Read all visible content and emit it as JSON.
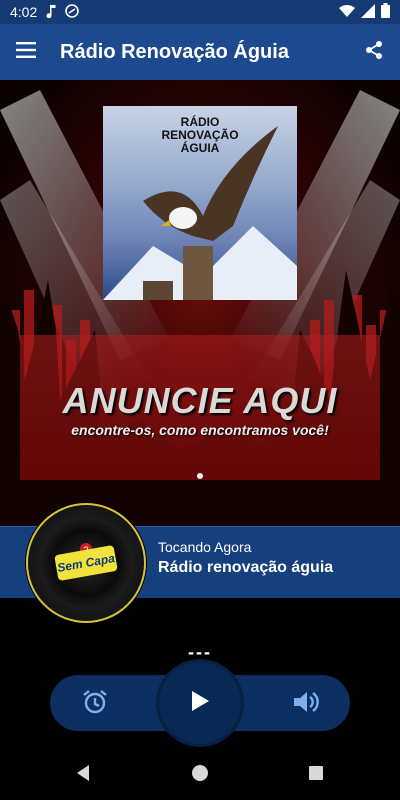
{
  "status_bar": {
    "time": "4:02"
  },
  "app_bar": {
    "title": "Rádio Renovação Águia"
  },
  "album_art": {
    "text_lines": [
      "RÁDIO",
      "RENOVAÇÃO",
      "ÁGUIA"
    ]
  },
  "banner": {
    "title": "ANUNCIE AQUI",
    "subtitle": "encontre-os, como encontramos você!"
  },
  "now_playing": {
    "label": "Tocando Agora",
    "station": "Rádio renovação águia",
    "cover_text": "Sem Capa"
  },
  "player": {
    "time_display": "---"
  },
  "colors": {
    "status_bar": "#153a74",
    "app_bar": "#1d4a8e",
    "now_playing": "#163f7e",
    "controls": "#0c2f62",
    "play_button": "#082855",
    "icon_blue": "#7fb0ee"
  }
}
